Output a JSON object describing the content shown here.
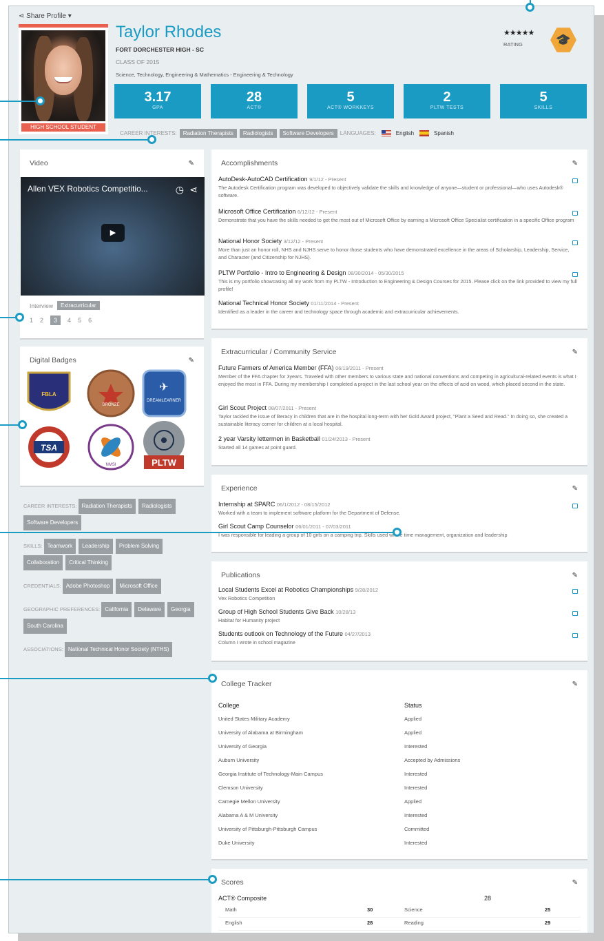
{
  "profile": {
    "share": "Share Profile",
    "name": "Taylor Rhodes",
    "school": "FORT DORCHESTER HIGH - SC",
    "class": "CLASS OF 2015",
    "program": "Science, Technology, Engineering & Mathematics - Engineering & Technology",
    "photo_label": "HIGH SCHOOL STUDENT",
    "rating_label": "RATING",
    "stars": "★★★★★"
  },
  "stats": [
    {
      "value": "3.17",
      "label": "GPA"
    },
    {
      "value": "28",
      "label": "ACT®"
    },
    {
      "value": "5",
      "label": "ACT® WORKKEYS"
    },
    {
      "value": "2",
      "label": "PLTW TESTS"
    },
    {
      "value": "5",
      "label": "SKILLS"
    }
  ],
  "interests": {
    "label": "CAREER INTERESTS:",
    "tags": [
      "Radiation Therapists",
      "Radiologists",
      "Software Developers"
    ],
    "lang_label": "LANGUAGES:",
    "languages": [
      "English",
      "Spanish"
    ]
  },
  "video": {
    "title": "Video",
    "video_title": "Allen VEX Robotics Competitio...",
    "tabs": [
      "Interview",
      "Extracurricular"
    ],
    "pages": [
      "1",
      "2",
      "3",
      "4",
      "5",
      "6"
    ]
  },
  "badges": {
    "title": "Digital Badges",
    "items": [
      "FBLA",
      "BRONZE",
      "DREAMLEARNER",
      "TSA",
      "NMSI",
      "PLTW"
    ]
  },
  "sidebar": {
    "career_label": "CAREER INTERESTS:",
    "career": [
      "Radiation Therapists",
      "Radiologists",
      "Software Developers"
    ],
    "skills_label": "SKILLS:",
    "skills": [
      "Teamwork",
      "Leadership",
      "Problem Solving",
      "Collaboration",
      "Critical Thinking"
    ],
    "cred_label": "CREDENTIALS:",
    "credentials": [
      "Adobe Photoshop",
      "Microsoft Office"
    ],
    "geo_label": "GEOGRAPHIC PREFERENCES:",
    "geo": [
      "California",
      "Delaware",
      "Georgia",
      "South Carolina"
    ],
    "assoc_label": "ASSOCIATIONS:",
    "assoc": [
      "National Technical Honor Society (NTHS)"
    ]
  },
  "accomplishments": {
    "title": "Accomplishments",
    "items": [
      {
        "t": "AutoDesk-AutoCAD Certification",
        "d": "9/1/12 - Present",
        "x": "The Autodesk Certification program was developed to objectively validate the skills and knowledge of anyone—student or professional—who uses Autodesk® software."
      },
      {
        "t": "Microsoft Office Certification",
        "d": "6/12/12 - Present",
        "x": "Demonstrate that you have the skills needed to get the most out of Microsoft Office by earning a Microsoft Office Specialist certification in a specific Office program"
      },
      {
        "t": "National Honor Society",
        "d": "3/12/12 - Present",
        "x": "More than just an honor roll, NHS and NJHS serve to honor those students who have demonstrated excellence in the areas of Scholarship, Leadership, Service, and Character (and Citizenship for NJHS)."
      },
      {
        "t": "PLTW Portfolio - Intro to Engineering & Design",
        "d": "08/30/2014 - 05/30/2015",
        "x": "This is my portfolio showcasing all my work from my PLTW - Introduction to Engineering & Design Courses for 2015. Please click on the link provided to view my full profile!"
      },
      {
        "t": "National Technical Honor Society",
        "d": "01/11/2014 - Present",
        "x": "Identified as a leader in the career and technology space through academic and extracurricular achievements."
      }
    ]
  },
  "extracurricular": {
    "title": "Extracurricular / Community Service",
    "items": [
      {
        "t": "Future Farmers of America Member (FFA)",
        "d": "06/19/2011  -  Present",
        "x": "Member of the FFA chapter for 3years. Traveled with other members to various state and national conventions and competing in agricultural-related events is what I enjoyed the most in FFA. During my membership I completed a project in the last school year on the effects of acid on wood, which placed second in the state."
      },
      {
        "t": "Girl Scout Project",
        "d": "08/07/2011  -  Present",
        "x": "Taylor tackled the issue of literacy in children that are in the hospital long-term with her Gold Award project, \"Plant a Seed and Read.\" In doing so, she created a sustainable literacy corner for children at a local hospital."
      },
      {
        "t": "2 year Varsity lettermen in Basketball",
        "d": "01/24/2013  -  Present",
        "x": "Started all 14 games at point guard."
      }
    ]
  },
  "experience": {
    "title": "Experience",
    "items": [
      {
        "t": "Internship at SPARC",
        "d": "06/1/2012  -  08/15/2012",
        "x": "Worked with a team to implement software platform for the Department of Defense."
      },
      {
        "t": "Girl Scout Camp Counselor",
        "d": "06/01/2011  -  07/03/2011",
        "x": "I was responsible for leading a group of 10 girls on a camping trip. Skills used where time management, organization and leadership"
      }
    ]
  },
  "publications": {
    "title": "Publications",
    "items": [
      {
        "t": "Local Students Excel at Robotics Championships",
        "d": "9/28/2012",
        "x": "Vex Robotics Competition"
      },
      {
        "t": "Group of High School Students Give Back",
        "d": "10/28/13",
        "x": "Habitat for Humanity project"
      },
      {
        "t": "Students outlook on Technology of the Future",
        "d": "04/27/2013",
        "x": "Column I wrote in school magazine"
      }
    ]
  },
  "college": {
    "title": "College Tracker",
    "h1": "College",
    "h2": "Status",
    "rows": [
      [
        "United States Military Academy",
        "Applied"
      ],
      [
        "University of Alabama at Birmingham",
        "Applied"
      ],
      [
        "University of Georgia",
        "Interested"
      ],
      [
        "Auburn University",
        "Accepted by Admissions"
      ],
      [
        "Georgia Institute of Technology-Main Campus",
        "Interested"
      ],
      [
        "Clemson University",
        "Interested"
      ],
      [
        "Carnegie Mellon University",
        "Applied"
      ],
      [
        "Alabama A & M University",
        "Interested"
      ],
      [
        "University of Pittsburgh-Pittsburgh Campus",
        "Committed"
      ],
      [
        "Duke University",
        "Interested"
      ]
    ]
  },
  "scores": {
    "title": "Scores",
    "composite_label": "ACT® Composite",
    "composite": "28",
    "rows": [
      {
        "a": "Math",
        "av": "30",
        "b": "Science",
        "bv": "25"
      },
      {
        "a": "English",
        "av": "28",
        "b": "Reading",
        "bv": "29"
      }
    ]
  }
}
